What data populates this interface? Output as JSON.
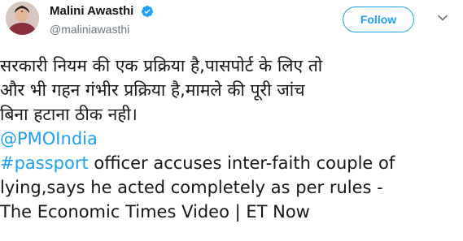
{
  "user": {
    "display_name": "Malini Awasthi",
    "handle": "@maliniawasthi",
    "verified": true
  },
  "actions": {
    "follow_label": "Follow",
    "more_icon": "chevron-down-icon"
  },
  "tweet": {
    "hindi_lines": [
      "सरकारी नियम की एक प्रक्रिया है,पासपोर्ट के लिए तो",
      "और भी गहन गंभीर प्रक्रिया है,मामले की पूरी जांच",
      "बिना हटाना ठीक नही।"
    ],
    "mention": "@PMOIndia",
    "hashtag": "#passport",
    "line_after_hashtag": " officer accuses inter-faith couple of",
    "english_lines": [
      "lying,says he acted completely as per rules -",
      "The Economic Times Video | ET Now"
    ]
  },
  "colors": {
    "link": "#1da1f2",
    "text": "#14171a",
    "secondary": "#657786"
  }
}
